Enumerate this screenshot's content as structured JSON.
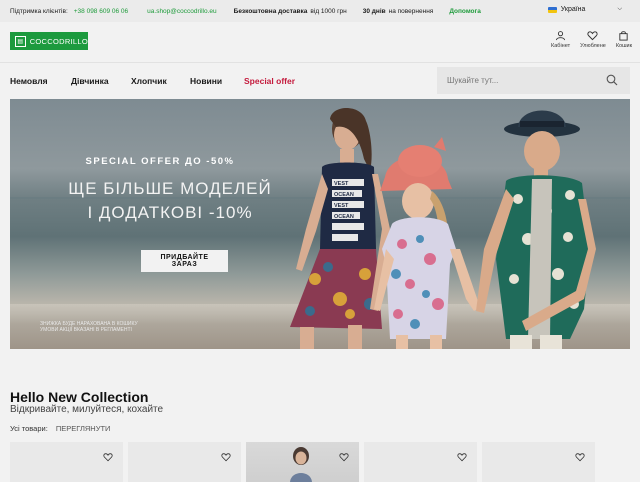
{
  "topbar": {
    "support_label": "Підтримка клієнтів:",
    "phone": "+38 098 609 06 06",
    "email": "ua.shop@coccodrillo.eu",
    "shipping_bold": "Безкоштовна доставка",
    "shipping_rest": "від 1000 грн",
    "returns_bold": "30 днів",
    "returns_rest": "на повернення",
    "help": "Допомога",
    "country": "Україна"
  },
  "header": {
    "logo_text": "COCCODRILLO",
    "icons": [
      {
        "label": "Кабінет",
        "icon": "user-icon"
      },
      {
        "label": "Улюблене",
        "icon": "heart-icon"
      },
      {
        "label": "Кошик",
        "icon": "bag-icon"
      }
    ]
  },
  "nav": {
    "items": [
      "Немовля",
      "Дівчинка",
      "Хлопчик",
      "Новини",
      "Special offer"
    ],
    "search_placeholder": "Шукайте тут..."
  },
  "banner": {
    "offer_small": "SPECIAL OFFER ДО -50%",
    "offer_line1": "ЩЕ БІЛЬШЕ МОДЕЛЕЙ",
    "offer_line2": "І ДОДАТКОВІ -10%",
    "cta": "ПРИДБАЙТЕ ЗАРАЗ",
    "fine_print_1": "ЗНИЖКА БУДЕ НАРАХОВАНА В КОШИКУ",
    "fine_print_2": "УМОВИ АКЦІЇ ВКАЗАНІ В РЕГЛАМЕНТІ",
    "tshirt_text": "VEST OCEAN VEST OCEAN"
  },
  "collection": {
    "title": "Hello New Collection",
    "subtitle": "Відкривайте, милуйтеся, кохайте",
    "filter_label": "Усі товари:",
    "filter_link": "ПЕРЕГЛЯНУТИ"
  },
  "colors": {
    "brand_green": "#1c9a3e",
    "special_red": "#c41a3c"
  }
}
